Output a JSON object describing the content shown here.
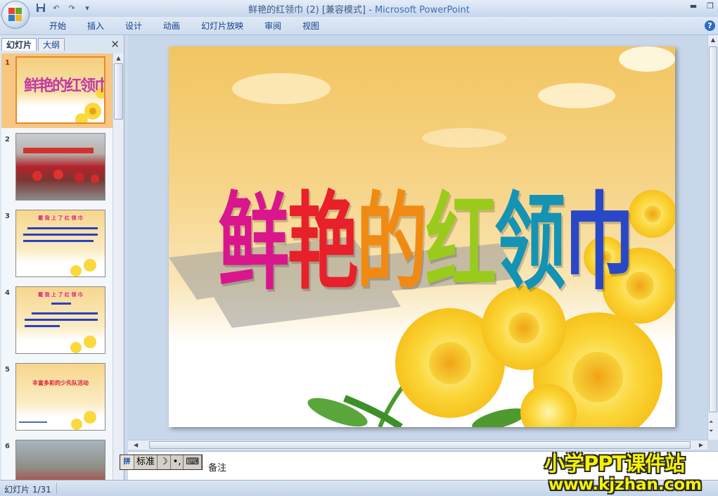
{
  "window": {
    "title": "鲜艳的红领巾 (2) [兼容模式]",
    "separator": " - ",
    "app_name": "Microsoft PowerPoint"
  },
  "ribbon": {
    "tabs": [
      "开始",
      "插入",
      "设计",
      "动画",
      "幻灯片放映",
      "审阅",
      "视图"
    ]
  },
  "left_pane": {
    "tab_slides": "幻灯片",
    "tab_outline": "大纲",
    "thumbnails": [
      {
        "num": "1",
        "title": "鲜艳的红领巾",
        "active": true
      },
      {
        "num": "2",
        "title": ""
      },
      {
        "num": "3",
        "title": "戴 我 上 了 红 领 巾"
      },
      {
        "num": "4",
        "title": "戴 我 上 了 红 领 巾"
      },
      {
        "num": "5",
        "title": "丰富多彩的少先队活动"
      },
      {
        "num": "6",
        "title": ""
      }
    ]
  },
  "slide": {
    "title": "鲜艳的红领巾",
    "title_colors": [
      "#d9168c",
      "#e8202a",
      "#f18a12",
      "#9acb1c",
      "#1593b4",
      "#2948c8"
    ]
  },
  "notes": {
    "text": "备注"
  },
  "ime": {
    "mode": "标准",
    "moon": "☽",
    "punct": "•,",
    "keyboard": "⌨"
  },
  "watermark": {
    "line1": "小学PPT课件站",
    "line2": "www.kjzhan.com"
  },
  "statusbar": {
    "slide_indicator": "幻灯片 1/31"
  },
  "colors": {
    "ribbon_bg": "#cddcef",
    "active_thumb": "#f7c683",
    "watermark_yellow": "#f6f400"
  }
}
